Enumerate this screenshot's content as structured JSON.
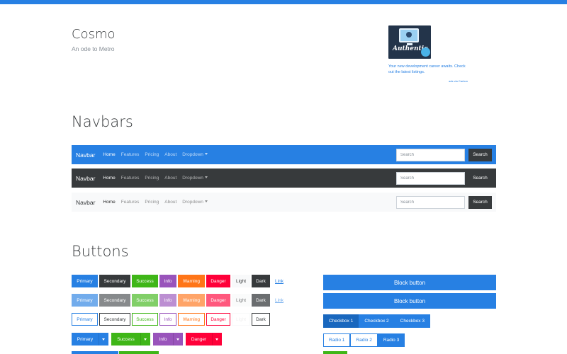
{
  "header": {
    "title": "Cosmo",
    "subtitle": "An ode to Metro"
  },
  "ad": {
    "image_label": "Authentic",
    "text": "Your new development career awaits. Check out the latest listings.",
    "via": "ads via Carbon"
  },
  "sections": {
    "navbars": "Navbars",
    "buttons": "Buttons"
  },
  "navbar": {
    "brand": "Navbar",
    "links": [
      "Home",
      "Features",
      "Pricing",
      "About",
      "Dropdown"
    ],
    "search_placeholder": "Search",
    "search_button": "Search"
  },
  "buttons": {
    "labels": [
      "Primary",
      "Secondary",
      "Success",
      "Info",
      "Warning",
      "Danger",
      "Light",
      "Dark",
      "Link"
    ],
    "split_labels": [
      "Primary",
      "Success",
      "Info",
      "Danger"
    ],
    "block": "Block button",
    "checkboxes": [
      "Checkbox 1",
      "Checkbox 2",
      "Checkbox 3"
    ],
    "radios": [
      "Radio 1",
      "Radio 2",
      "Radio 3"
    ]
  },
  "colors": {
    "primary": "#2780e3",
    "secondary": "#373a3c",
    "success": "#3fb618",
    "info": "#9954bb",
    "warning": "#ff7518",
    "danger": "#ff0039"
  }
}
